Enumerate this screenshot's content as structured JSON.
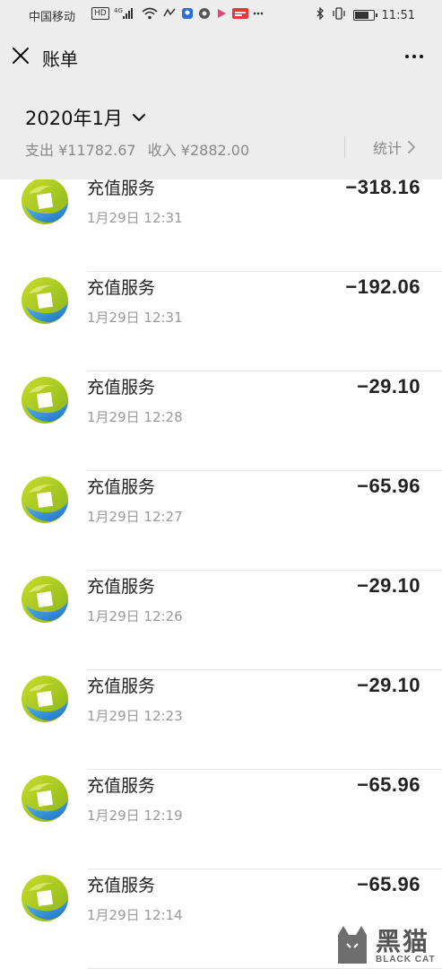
{
  "status_bar": {
    "carrier": "中国移动",
    "hd": "HD",
    "network": "4G",
    "time": "11:51",
    "battery_level": 0.8
  },
  "nav": {
    "title": "账单"
  },
  "header": {
    "month": "2020年1月",
    "expense_label": "支出 ¥11782.67",
    "income_label": "收入 ¥2882.00",
    "stats_label": "统计"
  },
  "transactions": [
    {
      "title": "充值服务",
      "time": "1月29日 12:31",
      "amount": "−318.16"
    },
    {
      "title": "充值服务",
      "time": "1月29日 12:31",
      "amount": "−192.06"
    },
    {
      "title": "充值服务",
      "time": "1月29日 12:28",
      "amount": "−29.10"
    },
    {
      "title": "充值服务",
      "time": "1月29日 12:27",
      "amount": "−65.96"
    },
    {
      "title": "充值服务",
      "time": "1月29日 12:26",
      "amount": "−29.10"
    },
    {
      "title": "充值服务",
      "time": "1月29日 12:23",
      "amount": "−29.10"
    },
    {
      "title": "充值服务",
      "time": "1月29日 12:19",
      "amount": "−65.96"
    },
    {
      "title": "充值服务",
      "time": "1月29日 12:14",
      "amount": "−65.96"
    }
  ],
  "watermark": {
    "cn": "黑猫",
    "en": "BLACK CAT"
  },
  "colors": {
    "header_bg": "#ededed",
    "logo_green": "#a4c81c",
    "logo_blue": "#2a8fd6"
  },
  "icons": {
    "close": "close-icon",
    "more": "more-dots-icon",
    "chevron_down": "chevron-down-icon",
    "chevron_right": "chevron-right-icon",
    "merchant_logo": "merchant-logo-icon"
  }
}
